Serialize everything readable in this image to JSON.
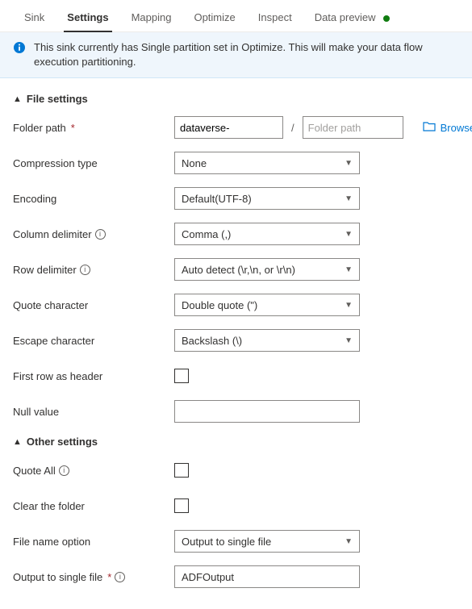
{
  "tabs": {
    "sink": "Sink",
    "settings": "Settings",
    "mapping": "Mapping",
    "optimize": "Optimize",
    "inspect": "Inspect",
    "data_preview": "Data preview"
  },
  "info_bar": {
    "text": "This sink currently has Single partition set in Optimize. This will make your data flow execution partitioning."
  },
  "sections": {
    "file_settings": "File settings",
    "other_settings": "Other settings"
  },
  "labels": {
    "folder_path": "Folder path",
    "compression_type": "Compression type",
    "encoding": "Encoding",
    "column_delimiter": "Column delimiter",
    "row_delimiter": "Row delimiter",
    "quote_character": "Quote character",
    "escape_character": "Escape character",
    "first_row_header": "First row as header",
    "null_value": "Null value",
    "quote_all": "Quote All",
    "clear_folder": "Clear the folder",
    "file_name_option": "File name option",
    "output_single_file": "Output to single file"
  },
  "values": {
    "folder_container": "dataverse-",
    "folder_placeholder": "Folder path",
    "browse": "Browse",
    "compression_type": "None",
    "encoding": "Default(UTF-8)",
    "column_delimiter": "Comma (,)",
    "row_delimiter": "Auto detect (\\r,\\n, or \\r\\n)",
    "quote_character": "Double quote (\")",
    "escape_character": "Backslash (\\)",
    "null_value": "",
    "file_name_option": "Output to single file",
    "output_single_file": "ADFOutput"
  }
}
